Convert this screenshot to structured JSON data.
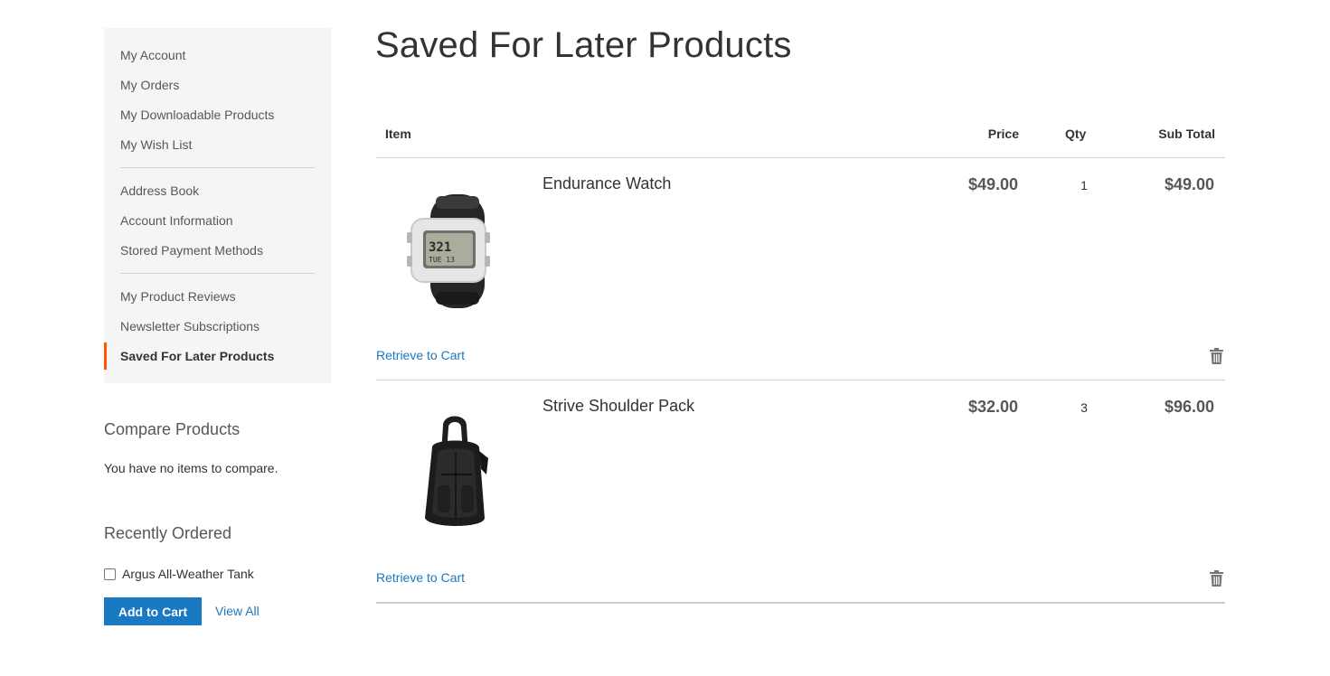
{
  "sidebar": {
    "nav": {
      "group1": [
        "My Account",
        "My Orders",
        "My Downloadable Products",
        "My Wish List"
      ],
      "group2": [
        "Address Book",
        "Account Information",
        "Stored Payment Methods"
      ],
      "group3": [
        "My Product Reviews",
        "Newsletter Subscriptions"
      ],
      "current": "Saved For Later Products"
    },
    "compare": {
      "title": "Compare Products",
      "empty_text": "You have no items to compare."
    },
    "recently_ordered": {
      "title": "Recently Ordered",
      "items": [
        {
          "name": "Argus All-Weather Tank",
          "checked": false
        }
      ],
      "add_to_cart_label": "Add to Cart",
      "view_all_label": "View All"
    }
  },
  "main": {
    "title": "Saved For Later Products",
    "columns": {
      "item": "Item",
      "price": "Price",
      "qty": "Qty",
      "subtotal": "Sub Total"
    },
    "products": [
      {
        "name": "Endurance Watch",
        "price": "$49.00",
        "qty": "1",
        "subtotal": "$49.00",
        "image_icon": "watch-image",
        "retrieve_label": "Retrieve to Cart"
      },
      {
        "name": "Strive Shoulder Pack",
        "price": "$32.00",
        "qty": "3",
        "subtotal": "$96.00",
        "image_icon": "backpack-image",
        "retrieve_label": "Retrieve to Cart"
      }
    ]
  },
  "colors": {
    "accent_blue": "#1979c3",
    "current_marker": "#ff5501",
    "sidebar_bg": "#f5f5f5"
  }
}
